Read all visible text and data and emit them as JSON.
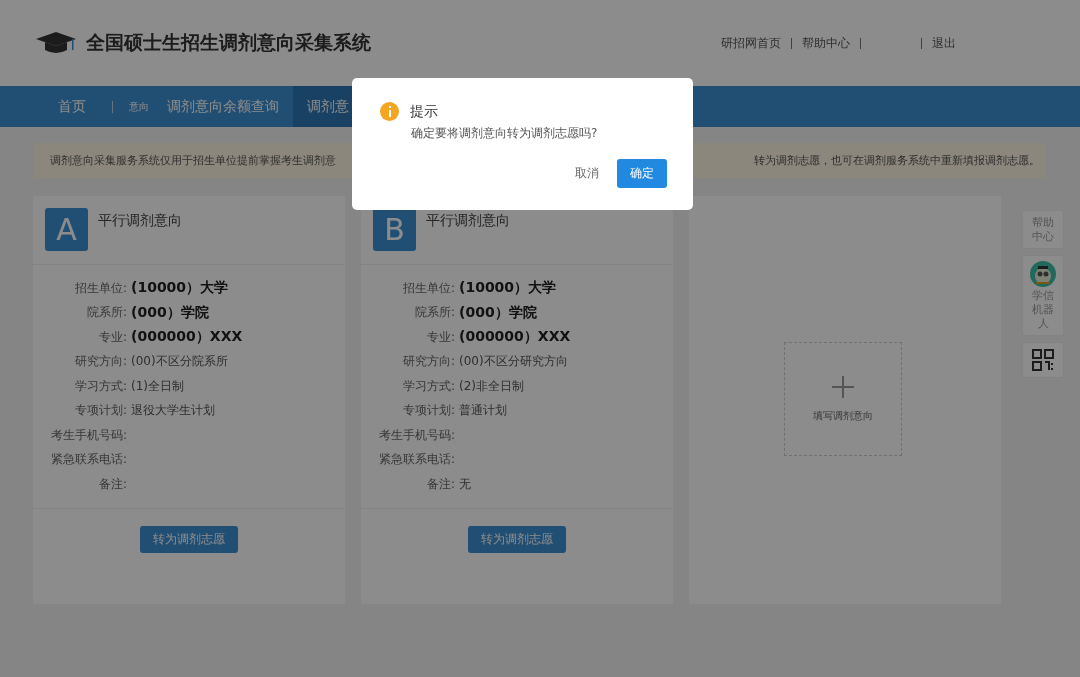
{
  "header": {
    "title": "全国硕士生招生调剂意向采集系统",
    "links": [
      "研招网首页",
      "帮助中心",
      "退出"
    ]
  },
  "nav": [
    {
      "label": "首页",
      "selected": false
    },
    {
      "label": "意向",
      "kind": "small",
      "selected": false
    },
    {
      "label": "调剂意向余额查询",
      "selected": false
    },
    {
      "label": "调剂意",
      "selected": true
    }
  ],
  "notice": [
    "调剂意向采集服务系统仅用于招生单位提前掌握考生调剂意",
    "转为调剂志愿，也可在调剂服务系统中重新填报调剂志愿。"
  ],
  "cards": [
    {
      "letter": "A",
      "title": "平行调剂意向",
      "fields": [
        {
          "label": "招生单位:",
          "value": "(10000）大学",
          "kind": "bold"
        },
        {
          "label": "院系所:",
          "value": "(000）学院",
          "kind": "bold"
        },
        {
          "label": "专业:",
          "value": "(000000）XXX",
          "kind": "bold"
        },
        {
          "label": "研究方向:",
          "value": "(00)不区分院系所",
          "kind": "plain"
        },
        {
          "label": "学习方式:",
          "value": "(1)全日制",
          "kind": "plain"
        },
        {
          "label": "专项计划:",
          "value": "退役大学生计划",
          "kind": "plain"
        },
        {
          "label": "考生手机号码:"
        },
        {
          "label": "紧急联系电话:"
        },
        {
          "label": "备注:"
        }
      ],
      "button": "转为调剂志愿"
    },
    {
      "letter": "B",
      "title": "平行调剂意向",
      "fields": [
        {
          "label": "招生单位:",
          "value": "(10000）大学",
          "kind": "bold"
        },
        {
          "label": "院系所:",
          "value": "(000）学院",
          "kind": "bold"
        },
        {
          "label": "专业:",
          "value": "(000000）XXX",
          "kind": "bold"
        },
        {
          "label": "研究方向:",
          "value": "(00)不区分研究方向",
          "kind": "plain"
        },
        {
          "label": "学习方式:",
          "value": "(2)非全日制",
          "kind": "plain"
        },
        {
          "label": "专项计划:",
          "value": "普通计划",
          "kind": "plain"
        },
        {
          "label": "考生手机号码:"
        },
        {
          "label": "紧急联系电话:"
        },
        {
          "label": "备注:",
          "value": "无",
          "kind": "plain"
        }
      ],
      "button": "转为调剂志愿"
    }
  ],
  "add_card": {
    "label": "填写调剂意向"
  },
  "float_bar": {
    "help": "帮助中心",
    "robot": "学信机器人"
  },
  "dialog": {
    "title": "提示",
    "message": "确定要将调剂意向转为调剂志愿吗?",
    "cancel": "取消",
    "ok": "确定"
  }
}
